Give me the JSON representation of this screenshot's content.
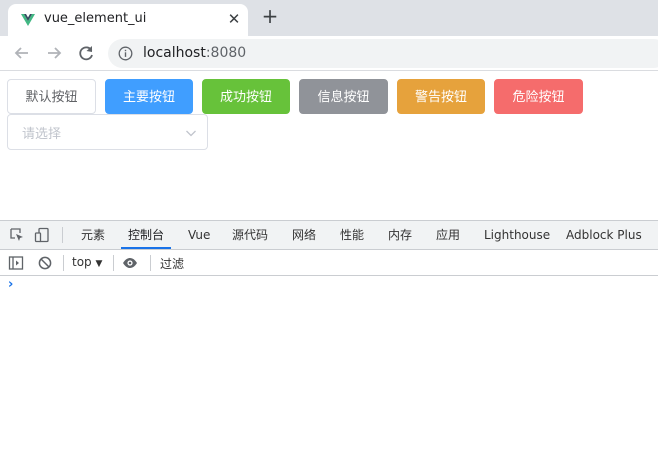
{
  "browser": {
    "tab_title": "vue_element_ui",
    "close_glyph": "✕",
    "new_tab_glyph": "+",
    "url_host": "localhost",
    "url_port": ":8080"
  },
  "page": {
    "buttons": [
      {
        "label": "默认按钮",
        "type": "default",
        "bg": "#ffffff",
        "border": "#dcdfe6",
        "color": "#606266"
      },
      {
        "label": "主要按钮",
        "type": "primary",
        "bg": "#409eff",
        "border": "#409eff",
        "color": "#ffffff"
      },
      {
        "label": "成功按钮",
        "type": "success",
        "bg": "#67c23a",
        "border": "#67c23a",
        "color": "#ffffff"
      },
      {
        "label": "信息按钮",
        "type": "info",
        "bg": "#909399",
        "border": "#909399",
        "color": "#ffffff"
      },
      {
        "label": "警告按钮",
        "type": "warning",
        "bg": "#e6a23c",
        "border": "#e6a23c",
        "color": "#ffffff"
      },
      {
        "label": "危险按钮",
        "type": "danger",
        "bg": "#f56c6c",
        "border": "#f56c6c",
        "color": "#ffffff"
      }
    ],
    "select": {
      "placeholder": "请选择"
    }
  },
  "devtools": {
    "tabs": [
      "元素",
      "控制台",
      "Vue",
      "源代码",
      "网络",
      "性能",
      "内存",
      "应用",
      "Lighthouse",
      "Adblock Plus"
    ],
    "active_tab": "控制台",
    "context": "top",
    "context_arrow": "▼",
    "filter_placeholder": "过滤",
    "prompt_glyph": "›"
  },
  "icons": {
    "tab_favicon": "vue-logo-icon",
    "back": "arrow-left-icon",
    "forward": "arrow-right-icon",
    "reload": "reload-icon",
    "site_info": "info-circle-icon",
    "select_arrow": "chevron-down-icon",
    "inspect": "inspect-element-icon",
    "device": "device-toolbar-icon",
    "sidebar": "console-sidebar-icon",
    "clear": "clear-console-icon",
    "eye": "live-expression-eye-icon"
  }
}
